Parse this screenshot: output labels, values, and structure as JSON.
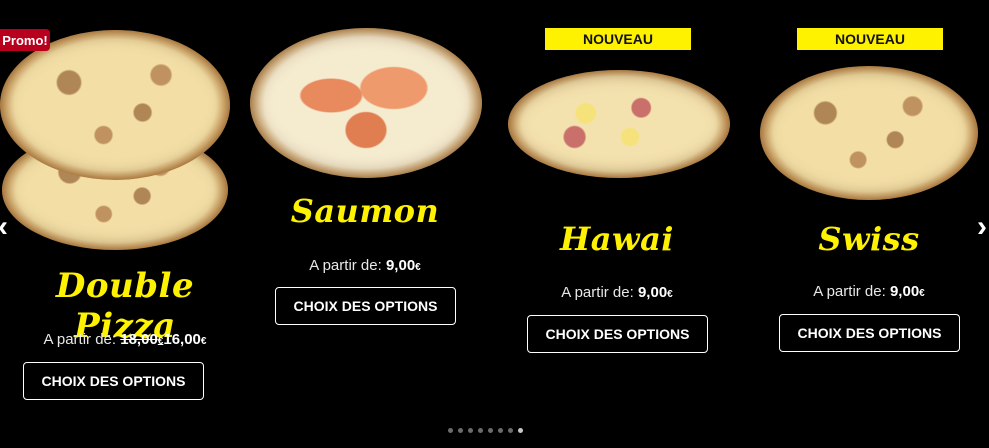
{
  "products": [
    {
      "id": "double-pizza",
      "name": "Double Pizza",
      "badge": "Promo!",
      "price_prefix": "A partir de:",
      "old_price": "18,00",
      "price": "16,00",
      "currency": "€",
      "button_label": "CHOIX DES OPTIONS",
      "image_icon": "double-pizza-image"
    },
    {
      "id": "saumon",
      "name": "Saumon",
      "badge": "",
      "price_prefix": "A partir de:",
      "price": "9,00",
      "currency": "€",
      "button_label": "CHOIX DES OPTIONS",
      "image_icon": "salmon-pizza-image"
    },
    {
      "id": "hawai",
      "name": "Hawai",
      "badge": "NOUVEAU",
      "price_prefix": "A partir de:",
      "price": "9,00",
      "currency": "€",
      "button_label": "CHOIX DES OPTIONS",
      "image_icon": "hawai-pizza-image"
    },
    {
      "id": "swiss",
      "name": "Swiss",
      "badge": "NOUVEAU",
      "price_prefix": "A partir de:",
      "price": "9,00",
      "currency": "€",
      "button_label": "CHOIX DES OPTIONS",
      "image_icon": "swiss-pizza-image"
    }
  ],
  "navigation": {
    "prev_icon": "chevron-left-icon",
    "next_icon": "chevron-right-icon",
    "prev_glyph": "‹",
    "next_glyph": "›"
  },
  "pagination": {
    "count": 8,
    "active_index": 7
  },
  "colors": {
    "background": "#000000",
    "accent_yellow": "#fff200",
    "promo_red": "#b8001e",
    "text": "#ffffff"
  }
}
